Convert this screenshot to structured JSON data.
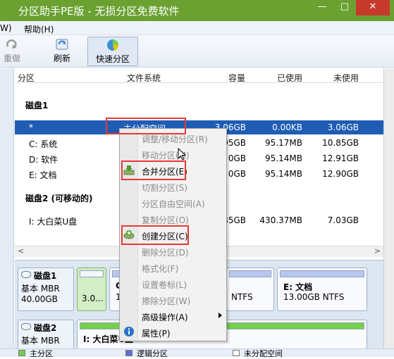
{
  "window": {
    "title": "分区助手PE版 - 无损分区免费软件",
    "min": "—",
    "max": "□",
    "close": "✕"
  },
  "menu": {
    "items": [
      "W)",
      "帮助(H)"
    ]
  },
  "toolbar": {
    "redo": "重做",
    "refresh": "刷新",
    "quick_partition": "快速分区"
  },
  "list": {
    "headers": {
      "partition": "分区",
      "filesystem": "文件系统",
      "capacity": "容量",
      "used": "已使用",
      "unused": "未使用"
    },
    "disk1_title": "磁盘1",
    "disk1_rows": [
      {
        "partition": "*",
        "filesystem": "未分配空间",
        "capacity": "3.06GB",
        "used": "0.00KB",
        "unused": "3.06GB"
      },
      {
        "partition": "C: 系统",
        "filesystem": "",
        "capacity": "95GB",
        "used": "95.17MB",
        "unused": "10.85GB"
      },
      {
        "partition": "D: 软件",
        "filesystem": "",
        "capacity": "0GB",
        "used": "95.14MB",
        "unused": "12.91GB"
      },
      {
        "partition": "E: 文档",
        "filesystem": "",
        "capacity": "0GB",
        "used": "95.14MB",
        "unused": "12.90GB"
      }
    ],
    "disk2_title": "磁盘2 (可移动的)",
    "disk2_rows": [
      {
        "partition": "I: 大白菜U盘",
        "filesystem": "",
        "capacity": "35GB",
        "used": "430.37MB",
        "unused": "7.03GB"
      }
    ],
    "scroll_left": "<",
    "scroll_right": ">"
  },
  "diskmap": {
    "disk1": {
      "name": "磁盘1",
      "type": "基本 MBR",
      "size": "40.00GB",
      "unalloc_label": "3.0...",
      "c_letter": "C",
      "c_size": "1",
      "d_fs": "NTFS",
      "e_name": "E: 文档",
      "e_info": "13.00GB NTFS"
    },
    "disk2": {
      "name": "磁盘2",
      "type": "基本 MBR",
      "part_name": "I: 大白菜U盘"
    }
  },
  "legend": {
    "primary": "主分区",
    "logical": "逻辑分区",
    "unallocated": "未分配空间"
  },
  "context_menu": {
    "items": [
      {
        "label": "调整/移动分区(R)",
        "enabled": false
      },
      {
        "label": "移动分区(M)",
        "enabled": false
      },
      {
        "label": "合并分区(E)",
        "enabled": true,
        "icon": "merge-icon"
      },
      {
        "label": "切割分区(S)",
        "enabled": false
      },
      {
        "label": "分区自由空间(A)",
        "enabled": false
      },
      {
        "label": "复制分区(O)",
        "enabled": false
      },
      {
        "label": "创建分区(C)",
        "enabled": true,
        "icon": "create-icon"
      },
      {
        "label": "删除分区(D)",
        "enabled": false
      },
      {
        "label": "格式化(F)",
        "enabled": false
      },
      {
        "label": "设置卷标(L)",
        "enabled": false
      },
      {
        "label": "擦除分区(W)",
        "enabled": false
      },
      {
        "label": "高级操作(A)",
        "enabled": true,
        "submenu": true
      },
      {
        "label": "属性(P)",
        "enabled": true,
        "icon": "info-icon"
      }
    ]
  },
  "colors": {
    "titlebar": "#6aa130",
    "selection": "#1f5db4",
    "highlight_box": "#e53935"
  }
}
